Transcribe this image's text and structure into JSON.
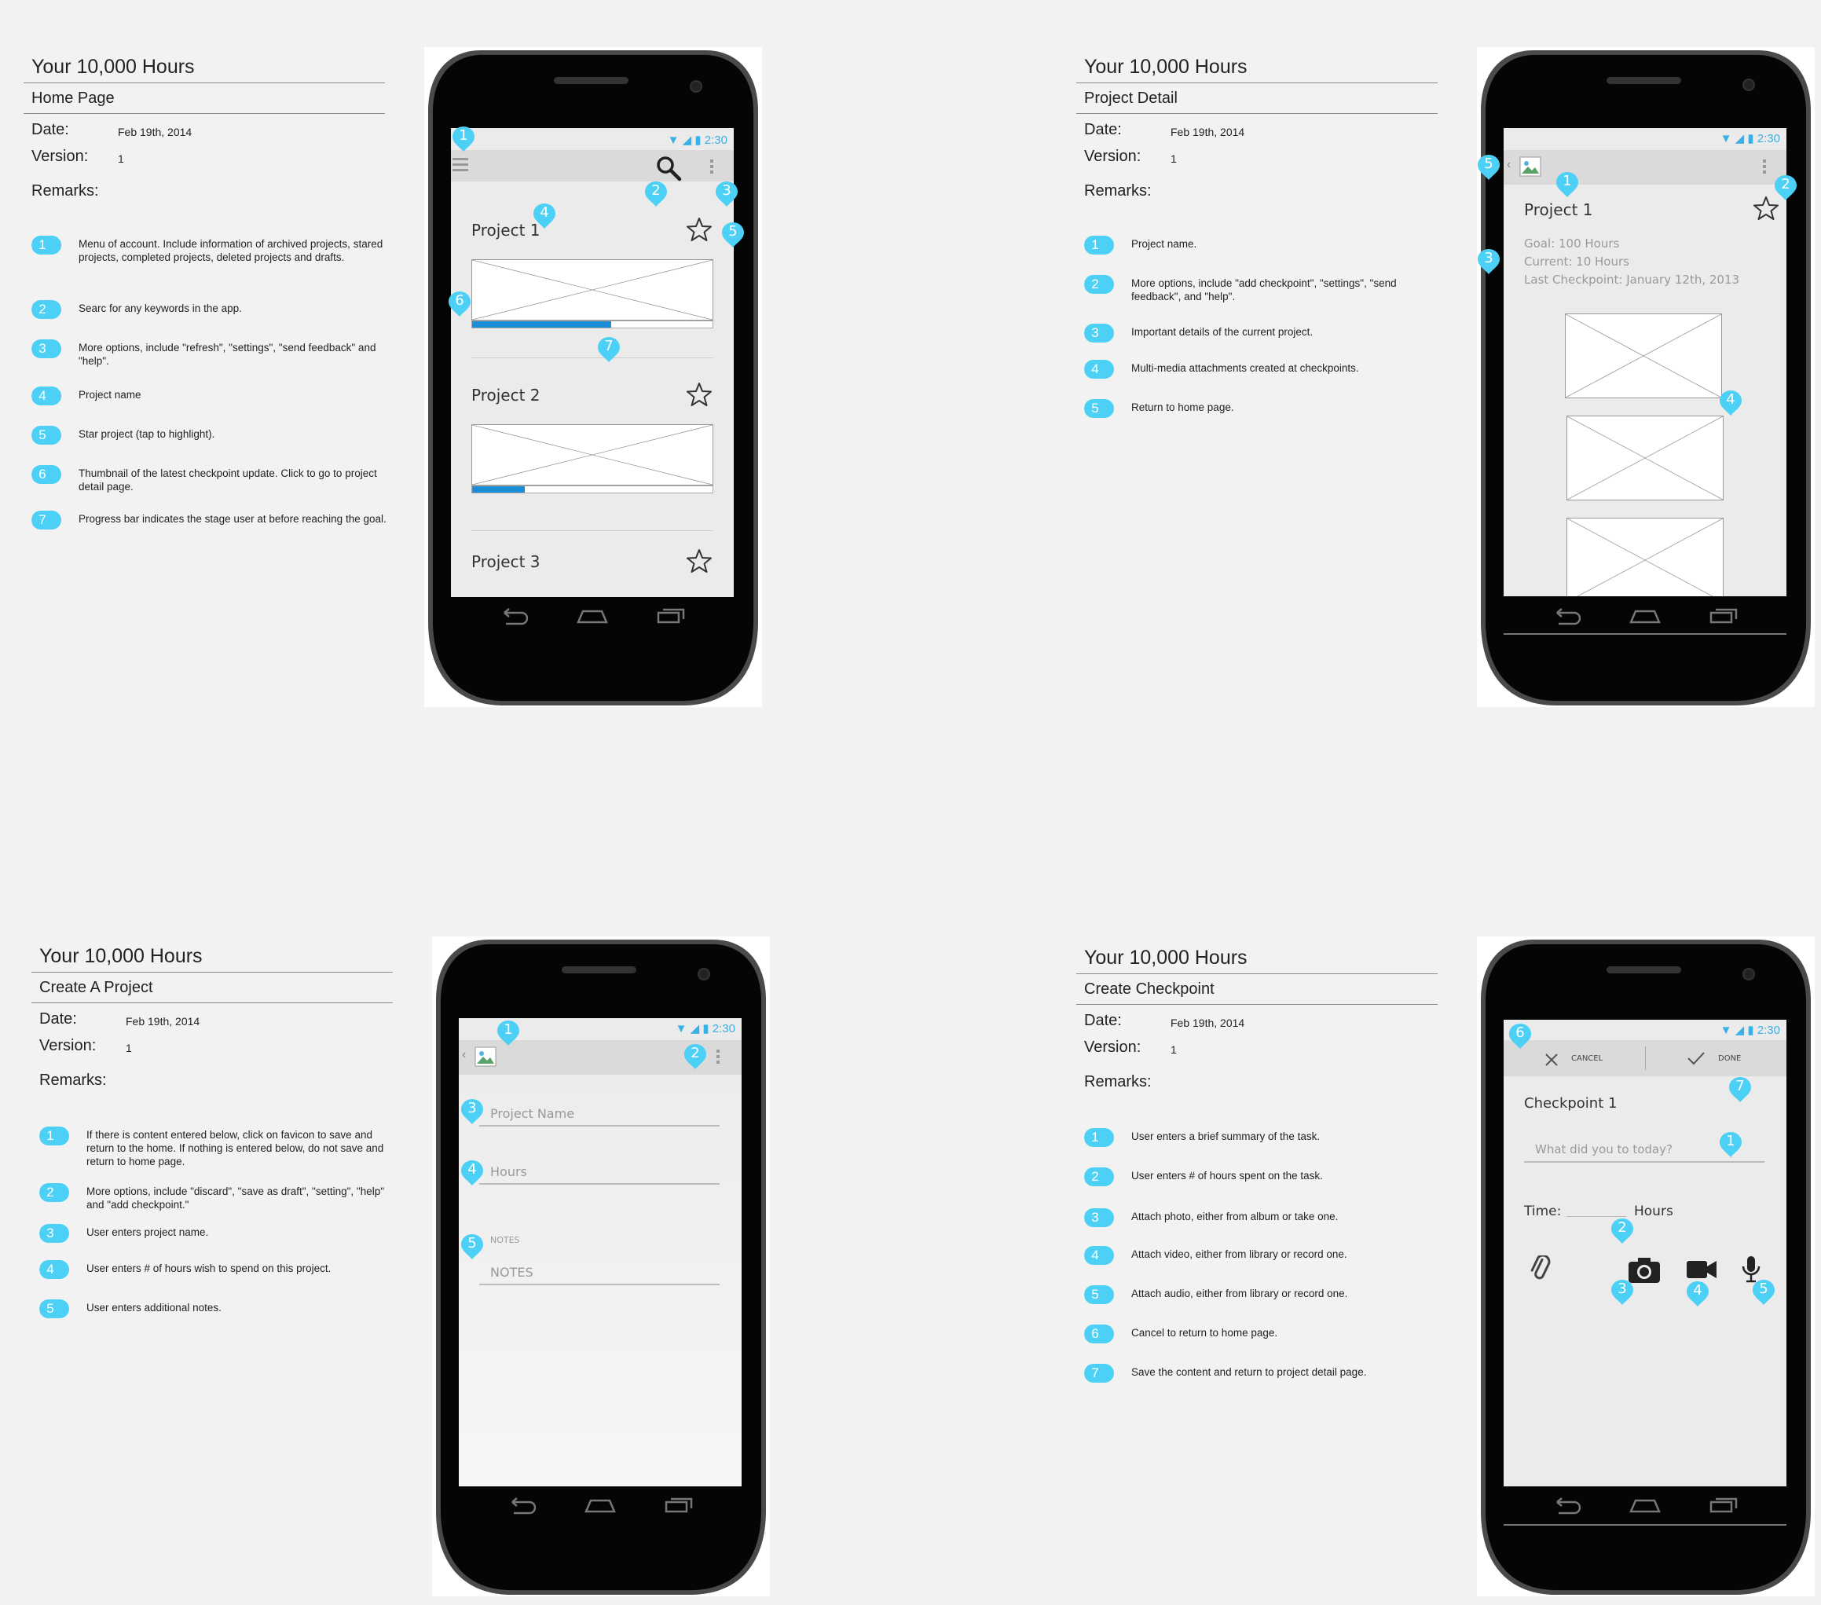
{
  "app_title": "Your 10,000 Hours",
  "labels": {
    "date": "Date:",
    "version": "Version:",
    "remarks": "Remarks:"
  },
  "status_time": "2:30",
  "panels": {
    "home": {
      "subtitle": "Home Page",
      "date": "Feb 19th, 2014",
      "version": "1",
      "remarks": [
        {
          "n": "1",
          "text": "Menu of account. Include information of archived projects, stared projects, completed projects, deleted projects and drafts."
        },
        {
          "n": "2",
          "text": "Searc for any keywords in the app."
        },
        {
          "n": "3",
          "text": "More options, include \"refresh\", \"settings\", \"send feedback\" and \"help\"."
        },
        {
          "n": "4",
          "text": "Project name"
        },
        {
          "n": "5",
          "text": "Star project (tap to highlight)."
        },
        {
          "n": "6",
          "text": "Thumbnail of the latest checkpoint update. Click to go to project detail page."
        },
        {
          "n": "7",
          "text": "Progress bar indicates the stage user at before reaching the goal."
        }
      ],
      "projects": [
        {
          "name": "Project 1",
          "progress": 0.58
        },
        {
          "name": "Project 2",
          "progress": 0.22
        },
        {
          "name": "Project 3",
          "progress": 0
        }
      ],
      "callouts": [
        "1",
        "2",
        "3",
        "4",
        "5",
        "6",
        "7"
      ]
    },
    "detail": {
      "subtitle": "Project Detail",
      "date": "Feb 19th, 2014",
      "version": "1",
      "remarks": [
        {
          "n": "1",
          "text": "Project name."
        },
        {
          "n": "2",
          "text": "More options, include \"add checkpoint\", \"settings\", \"send feedback\", and \"help\"."
        },
        {
          "n": "3",
          "text": "Important details of the current project."
        },
        {
          "n": "4",
          "text": "Multi-media attachments created at checkpoints."
        },
        {
          "n": "5",
          "text": "Return to home page."
        }
      ],
      "project_name": "Project 1",
      "goal": "Goal: 100 Hours",
      "current": "Current: 10 Hours",
      "last_checkpoint": "Last Checkpoint: January 12th, 2013",
      "callouts": [
        "1",
        "2",
        "3",
        "4",
        "5"
      ]
    },
    "create": {
      "subtitle": "Create A Project",
      "date": "Feb 19th, 2014",
      "version": "1",
      "remarks": [
        {
          "n": "1",
          "text": "If there is content entered below, click on favicon to save and return to the home. If nothing is entered below, do not save and return to home page."
        },
        {
          "n": "2",
          "text": "More options, include \"discard\", \"save as draft\", \"setting\", \"help\" and \"add checkpoint.\""
        },
        {
          "n": "3",
          "text": "User enters project name."
        },
        {
          "n": "4",
          "text": "User enters # of hours wish to spend on this project."
        },
        {
          "n": "5",
          "text": "User enters additional notes."
        }
      ],
      "project_name_placeholder": "Project Name",
      "hours_placeholder": "Hours",
      "notes_label": "NOTES",
      "notes_placeholder": "NOTES",
      "callouts": [
        "1",
        "2",
        "3",
        "4",
        "5"
      ]
    },
    "checkpoint": {
      "subtitle": "Create Checkpoint",
      "date": "Feb 19th, 2014",
      "version": "1",
      "remarks": [
        {
          "n": "1",
          "text": "User enters a brief summary of the task."
        },
        {
          "n": "2",
          "text": "User enters # of hours spent on the task."
        },
        {
          "n": "3",
          "text": "Attach photo, either from album or take one."
        },
        {
          "n": "4",
          "text": "Attach video, either from library or record one."
        },
        {
          "n": "5",
          "text": "Attach audio, either from library or record one."
        },
        {
          "n": "6",
          "text": "Cancel to return to home page."
        },
        {
          "n": "7",
          "text": "Save the content and return to project detail page."
        }
      ],
      "cancel_label": "CANCEL",
      "done_label": "DONE",
      "checkpoint_title": "Checkpoint 1",
      "summary_placeholder": "What did you to today?",
      "time_label": "Time:",
      "hours_label": "Hours",
      "callouts": [
        "1",
        "2",
        "3",
        "4",
        "5",
        "6",
        "7"
      ]
    }
  },
  "colors": {
    "callout": "#4dd0f5",
    "progress": "#1a8fd8",
    "status": "#39b1e6"
  },
  "icons": [
    "menu-icon",
    "search-icon",
    "overflow-menu-icon",
    "star-icon",
    "back-icon",
    "home-icon",
    "recents-icon",
    "app-favicon-icon",
    "cancel-x-icon",
    "done-check-icon",
    "paperclip-icon",
    "camera-icon",
    "video-icon",
    "microphone-icon",
    "wifi-icon",
    "signal-icon",
    "battery-icon"
  ]
}
